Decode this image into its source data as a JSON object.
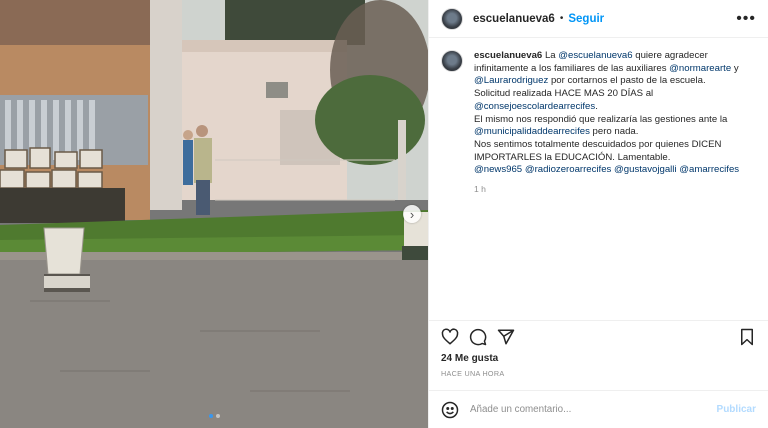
{
  "header": {
    "username": "escuelanueva6",
    "separator": "•",
    "follow_label": "Seguir",
    "more_icon": "more-dots-icon"
  },
  "caption": {
    "username": "escuelanueva6",
    "segments": [
      {
        "text": " La ",
        "mention": false
      },
      {
        "text": "@escuelanueva6",
        "mention": true
      },
      {
        "text": " quiere agradecer infinitamente a los familiares de las auxiliares ",
        "mention": false
      },
      {
        "text": "@normarearte",
        "mention": true
      },
      {
        "text": " y ",
        "mention": false
      },
      {
        "text": "@Laurarodriguez",
        "mention": true
      },
      {
        "text": " por cortarnos el pasto de la escuela.",
        "mention": false
      },
      {
        "text": "\nSolicitud realizada HACE MAS 20 DÍAS al ",
        "mention": false
      },
      {
        "text": "@consejoescolardearrecifes",
        "mention": true
      },
      {
        "text": ".\nEl mismo nos respondió que realizaría las gestiones ante la ",
        "mention": false
      },
      {
        "text": "@municipalidaddearrecifes",
        "mention": true
      },
      {
        "text": " pero nada.\nNos sentimos totalmente descuidados por quienes DICEN IMPORTARLES la EDUCACIÓN. Lamentable.\n",
        "mention": false
      },
      {
        "text": "@news965",
        "mention": true
      },
      {
        "text": " ",
        "mention": false
      },
      {
        "text": "@radiozeroarrecifes",
        "mention": true
      },
      {
        "text": " ",
        "mention": false
      },
      {
        "text": "@gustavojgalli",
        "mention": true
      },
      {
        "text": " ",
        "mention": false
      },
      {
        "text": "@amarrecifes",
        "mention": true
      }
    ],
    "time": "1 h"
  },
  "actions": {
    "like_icon": "heart-icon",
    "comment_icon": "comment-icon",
    "share_icon": "paper-plane-icon",
    "save_icon": "bookmark-icon"
  },
  "likes": "24 Me gusta",
  "posted_ago": "HACE UNA HORA",
  "comment_box": {
    "emoji_icon": "smiley-icon",
    "placeholder": "Añade un comentario...",
    "publish_label": "Publicar"
  },
  "media": {
    "next_icon": "chevron-right-icon",
    "carousel_count": 2,
    "carousel_active": 1
  },
  "colors": {
    "accent": "#0095f6",
    "mention": "#00376b",
    "publish_disabled": "#b3dbff",
    "muted": "#8e8e8e"
  }
}
